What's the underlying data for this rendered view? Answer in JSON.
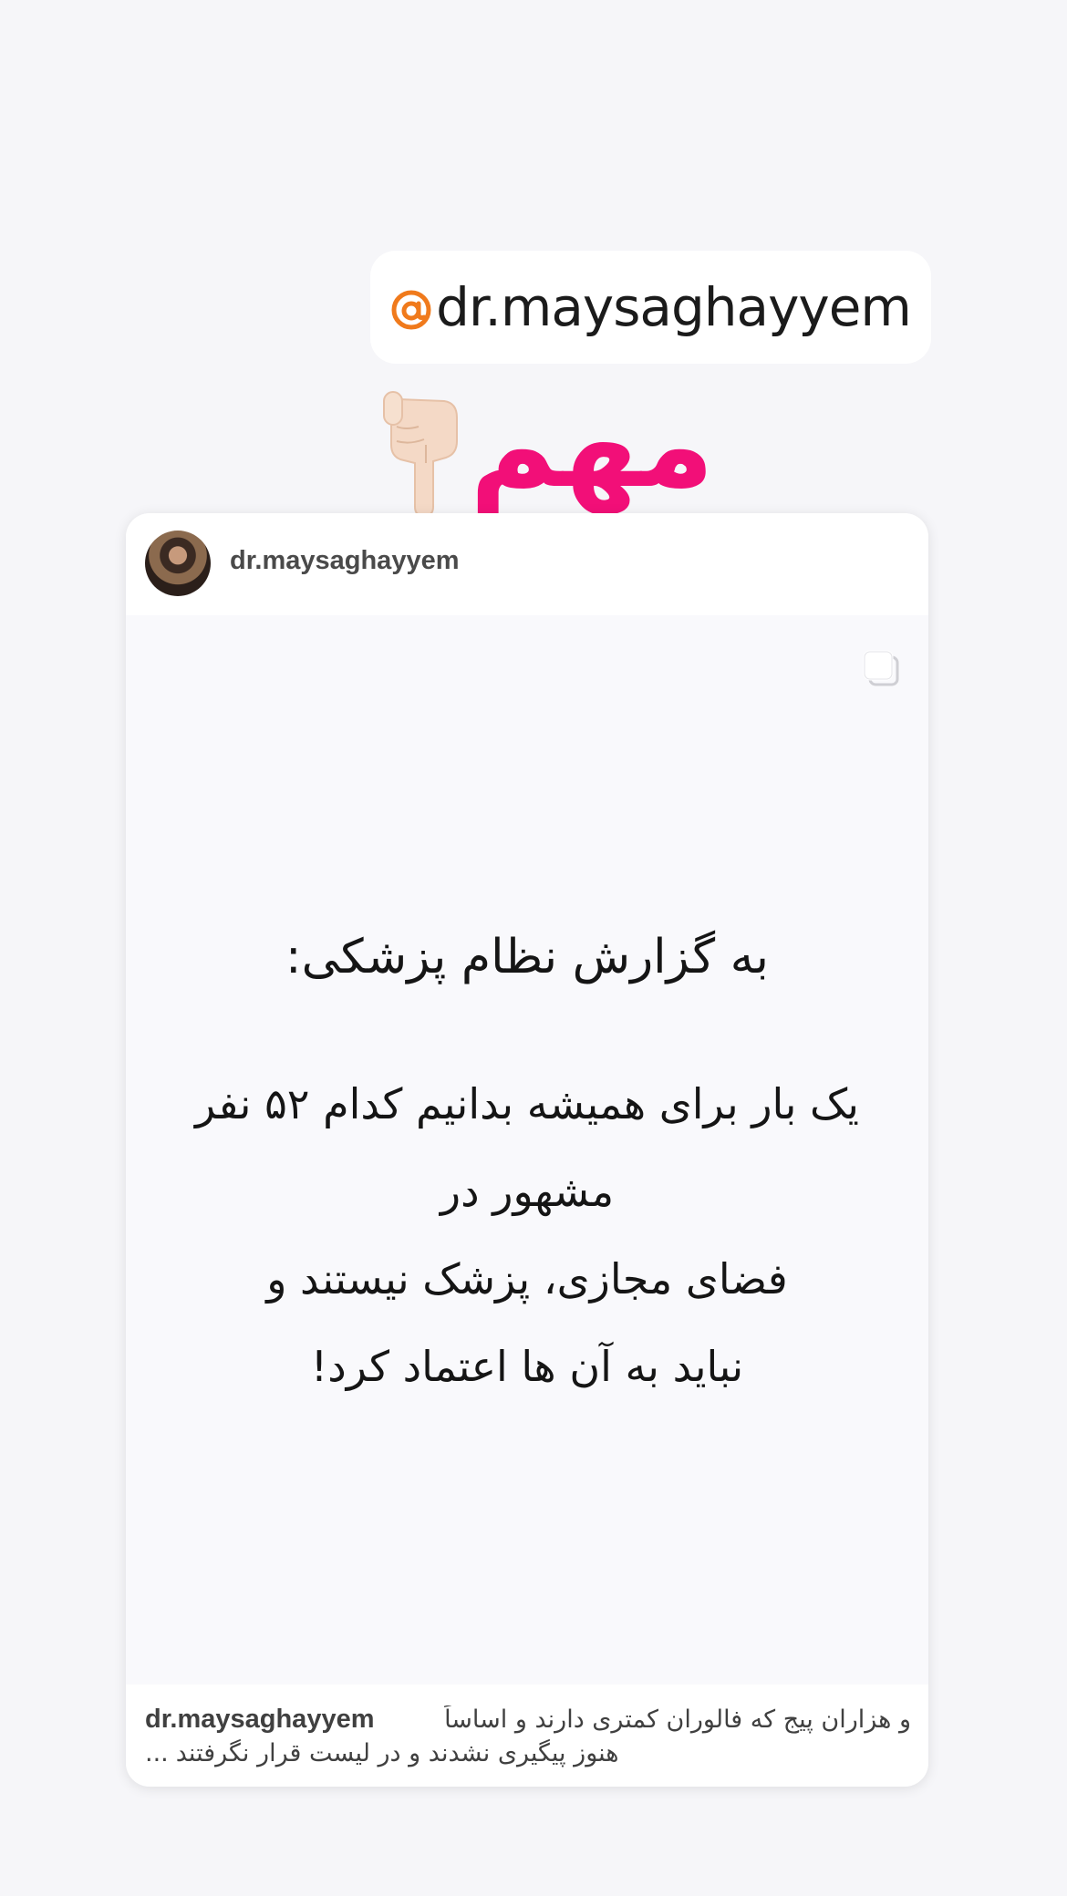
{
  "mention_sticker": {
    "text": "dr.maysaghayyem",
    "icon": "threads-at-icon",
    "icon_color": "#f07a1c"
  },
  "important_label": {
    "text": "مهم",
    "color": "#f20f78",
    "icon": "pointing-down-hand-icon"
  },
  "post": {
    "username": "dr.maysaghayyem",
    "avatar": "profile-photo",
    "carousel_icon": "multiple-posts-icon",
    "media_heading": "به گزارش نظام پزشکی:",
    "media_body_lines": [
      "یک بار برای همیشه بدانیم کدام ۵۲ نفر مشهور در",
      "فضای مجازی، پزشک نیستند و",
      "نباید به آن ها اعتماد کرد!"
    ],
    "caption": {
      "username": "dr.maysaghayyem",
      "line1": "و هزاران پیج که فالوران کمتری دارند و اساساً",
      "line2": "هنوز پیگیری نشدند و در لیست قرار نگرفتند",
      "ellipsis": "..."
    }
  }
}
